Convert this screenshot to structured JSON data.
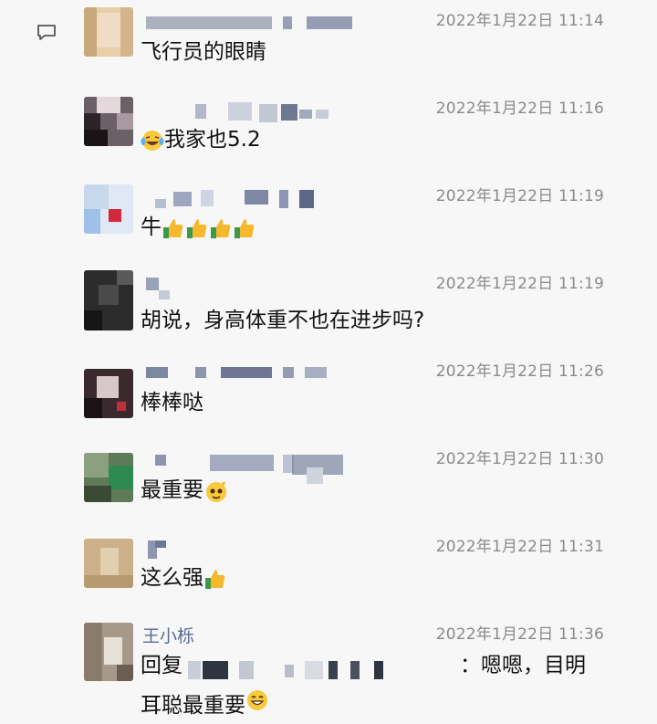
{
  "comments": [
    {
      "time": "2022年1月22日 11:14",
      "text": "飞行员的眼睛",
      "emojis": []
    },
    {
      "time": "2022年1月22日 11:16",
      "text": "我家也5.2",
      "emojis": [
        "laughing-tears-emoji"
      ]
    },
    {
      "time": "2022年1月22日 11:19",
      "text": "牛",
      "emojis": [
        "thumbs-up-emoji",
        "thumbs-up-emoji",
        "thumbs-up-emoji",
        "thumbs-up-emoji"
      ]
    },
    {
      "time": "2022年1月22日 11:19",
      "text": "胡说，身高体重不也在进步吗?",
      "emojis": []
    },
    {
      "time": "2022年1月22日 11:26",
      "text": "棒棒哒",
      "emojis": []
    },
    {
      "time": "2022年1月22日 11:30",
      "text": "最重要",
      "emojis": [
        "clever-emoji"
      ]
    },
    {
      "time": "2022年1月22日 11:31",
      "text": "这么强",
      "emojis": [
        "thumbs-up-emoji"
      ]
    },
    {
      "time": "2022年1月22日 11:36",
      "name": "王小栎",
      "reply_prefix": "回复",
      "reply_suffix": "：嗯嗯，目明",
      "line2": "耳聪最重要",
      "emojis": [
        "smile-emoji"
      ]
    }
  ],
  "colors": {
    "name": "#576b95",
    "time": "#8a8a8a",
    "text": "#111111",
    "background": "#f7f7f7"
  }
}
